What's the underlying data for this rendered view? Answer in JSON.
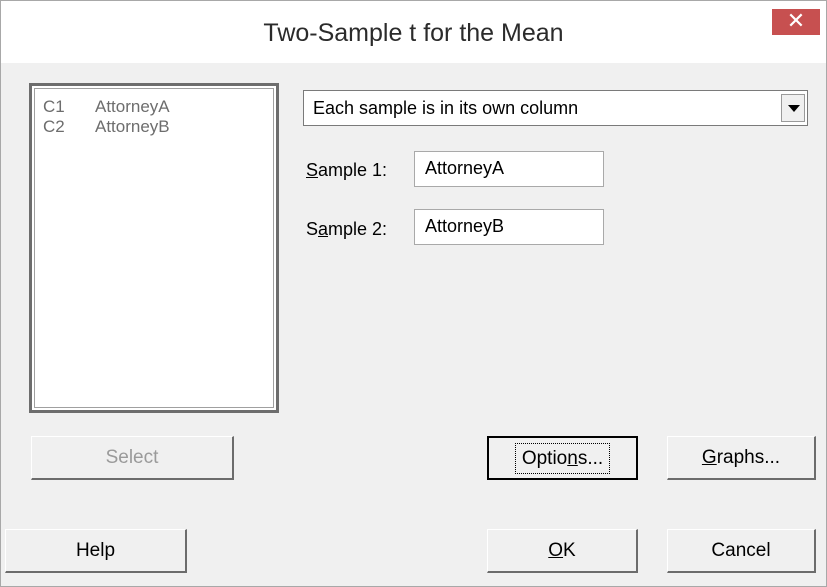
{
  "window": {
    "title": "Two-Sample t for the Mean",
    "close_label": "✕"
  },
  "variables": [
    {
      "column": "C1",
      "name": "AttorneyA"
    },
    {
      "column": "C2",
      "name": "AttorneyB"
    }
  ],
  "data_format": {
    "selected": "Each sample is in its own column"
  },
  "sample1": {
    "label_prefix": "",
    "label_mnemonic": "S",
    "label_rest": "ample 1:",
    "value": "AttorneyA"
  },
  "sample2": {
    "label_prefix": "S",
    "label_mnemonic": "a",
    "label_rest": "mple 2:",
    "value": "AttorneyB"
  },
  "buttons": {
    "select": "Select",
    "options_prefix": "Optio",
    "options_mnemonic": "n",
    "options_rest": "s...",
    "graphs_mnemonic": "G",
    "graphs_rest": "raphs...",
    "help": "Help",
    "ok_mnemonic": "O",
    "ok_rest": "K",
    "cancel": "Cancel"
  }
}
